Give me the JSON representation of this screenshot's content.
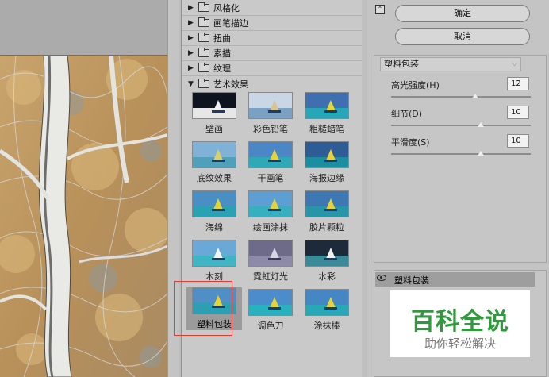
{
  "categories": [
    {
      "label": "风格化",
      "expanded": false
    },
    {
      "label": "画笔描边",
      "expanded": false
    },
    {
      "label": "扭曲",
      "expanded": false
    },
    {
      "label": "素描",
      "expanded": false
    },
    {
      "label": "纹理",
      "expanded": false
    },
    {
      "label": "艺术效果",
      "expanded": true
    }
  ],
  "filters": [
    {
      "label": "壁画"
    },
    {
      "label": "彩色铅笔"
    },
    {
      "label": "粗糙蜡笔"
    },
    {
      "label": "底纹效果"
    },
    {
      "label": "干画笔"
    },
    {
      "label": "海报边缘"
    },
    {
      "label": "海绵"
    },
    {
      "label": "绘画涂抹"
    },
    {
      "label": "胶片颗粒"
    },
    {
      "label": "木刻"
    },
    {
      "label": "霓虹灯光"
    },
    {
      "label": "水彩"
    },
    {
      "label": "塑料包装",
      "selected": true
    },
    {
      "label": "调色刀"
    },
    {
      "label": "涂抹棒"
    }
  ],
  "buttons": {
    "ok": "确定",
    "cancel": "取消"
  },
  "settings": {
    "filter_select": "塑料包装",
    "params": [
      {
        "label": "高光强度(H)",
        "value": "12",
        "fraction": 0.6
      },
      {
        "label": "细节(D)",
        "value": "10",
        "fraction": 0.64
      },
      {
        "label": "平滑度(S)",
        "value": "10",
        "fraction": 0.64
      }
    ]
  },
  "layer": {
    "label": "塑料包装"
  },
  "watermark": {
    "title": "百科全说",
    "subtitle": "助你轻松解决"
  },
  "colors": {
    "accent_red": "#e53935",
    "watermark_green": "#2e9b3b"
  }
}
